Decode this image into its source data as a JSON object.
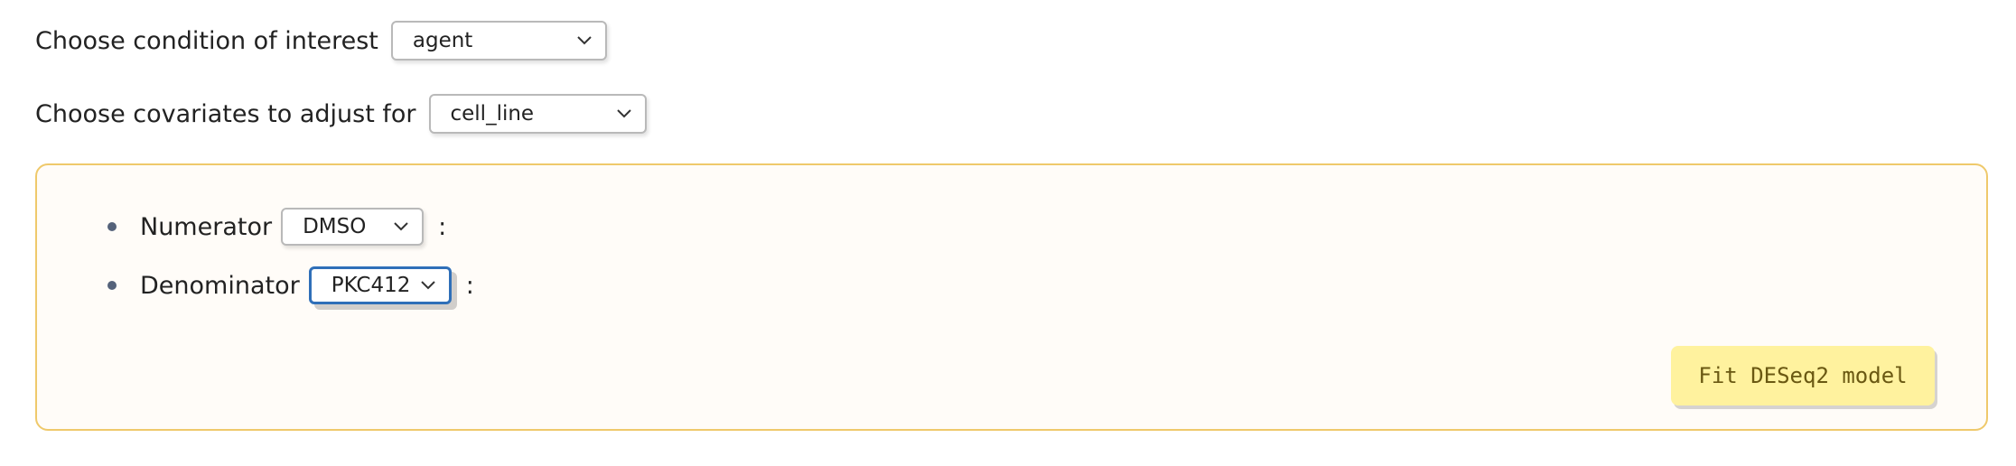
{
  "condition": {
    "label": "Choose condition of interest",
    "selected": "agent"
  },
  "covariates": {
    "label": "Choose covariates to adjust for",
    "selected": "cell_line"
  },
  "levels": {
    "numerator": {
      "label": "Numerator",
      "selected": "DMSO",
      "suffix": ":"
    },
    "denominator": {
      "label": "Denominator",
      "selected": "PKC412",
      "suffix": ":"
    }
  },
  "fit_button": {
    "label": "Fit DESeq2 model"
  },
  "colors": {
    "panel_border": "#efc96b",
    "panel_background": "#fffcf8",
    "button_background": "#fff29e",
    "focus_ring": "#2f6fb8"
  },
  "icons": {
    "dropdown": "chevron-down-icon",
    "bullet": "bullet-dot"
  }
}
